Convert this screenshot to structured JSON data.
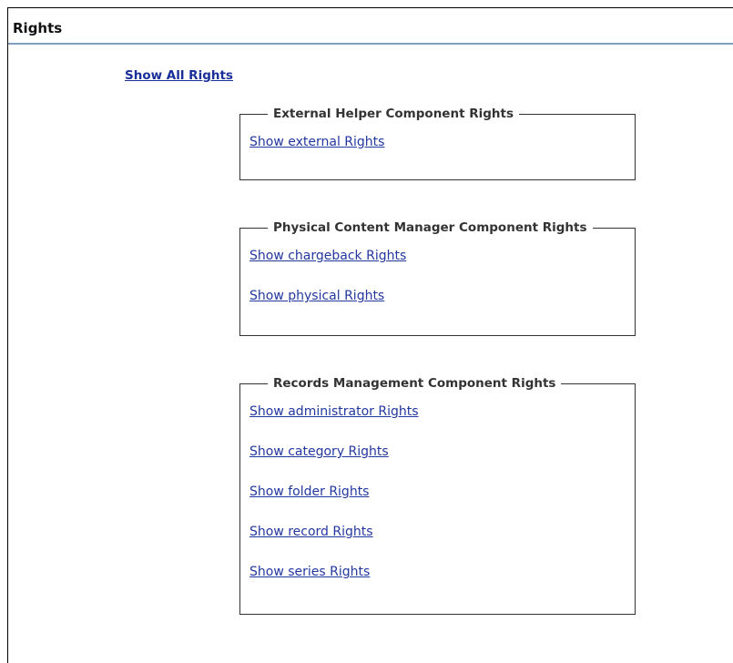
{
  "header": {
    "title": "Rights"
  },
  "show_all_link": "Show All Rights",
  "groups": [
    {
      "legend": "External Helper Component Rights",
      "links": [
        "Show external Rights"
      ]
    },
    {
      "legend": "Physical Content Manager Component Rights",
      "links": [
        "Show chargeback Rights",
        "Show physical Rights"
      ]
    },
    {
      "legend": "Records Management Component Rights",
      "links": [
        "Show administrator Rights",
        "Show category Rights",
        "Show folder Rights",
        "Show record Rights",
        "Show series Rights"
      ]
    }
  ],
  "colors": {
    "link": "#23379e",
    "header_rule": "#7f9fbf"
  }
}
